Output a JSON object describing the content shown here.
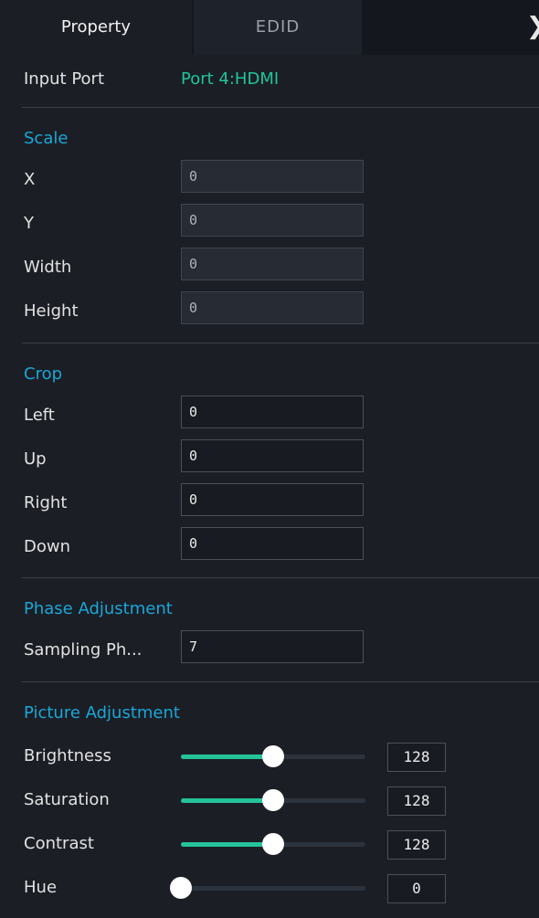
{
  "tabs": {
    "back_icon": "chevron-left-icon",
    "forward_icon": "chevron-right-icon",
    "property": "Property",
    "edid": "EDID"
  },
  "arrows": {
    "left": "❮",
    "right": "❯"
  },
  "input_port": {
    "label": "Input Port",
    "value": "Port 4:HDMI"
  },
  "scale": {
    "title": "Scale",
    "fields": [
      {
        "label": "X",
        "value": "0"
      },
      {
        "label": "Y",
        "value": "0"
      },
      {
        "label": "Width",
        "value": "0"
      },
      {
        "label": "Height",
        "value": "0"
      }
    ]
  },
  "crop": {
    "title": "Crop",
    "fields": [
      {
        "label": "Left",
        "value": "0"
      },
      {
        "label": "Up",
        "value": "0"
      },
      {
        "label": "Right",
        "value": "0"
      },
      {
        "label": "Down",
        "value": "0"
      }
    ]
  },
  "phase": {
    "title": "Phase Adjustment",
    "label": "Sampling Ph...",
    "value": "7"
  },
  "picture": {
    "title": "Picture Adjustment",
    "accent_color": "#25c39a",
    "sliders": [
      {
        "label": "Brightness",
        "value": "128",
        "fraction": 0.5
      },
      {
        "label": "Saturation",
        "value": "128",
        "fraction": 0.5
      },
      {
        "label": "Contrast",
        "value": "128",
        "fraction": 0.5
      },
      {
        "label": "Hue",
        "value": "0",
        "fraction": 0.0
      }
    ]
  }
}
